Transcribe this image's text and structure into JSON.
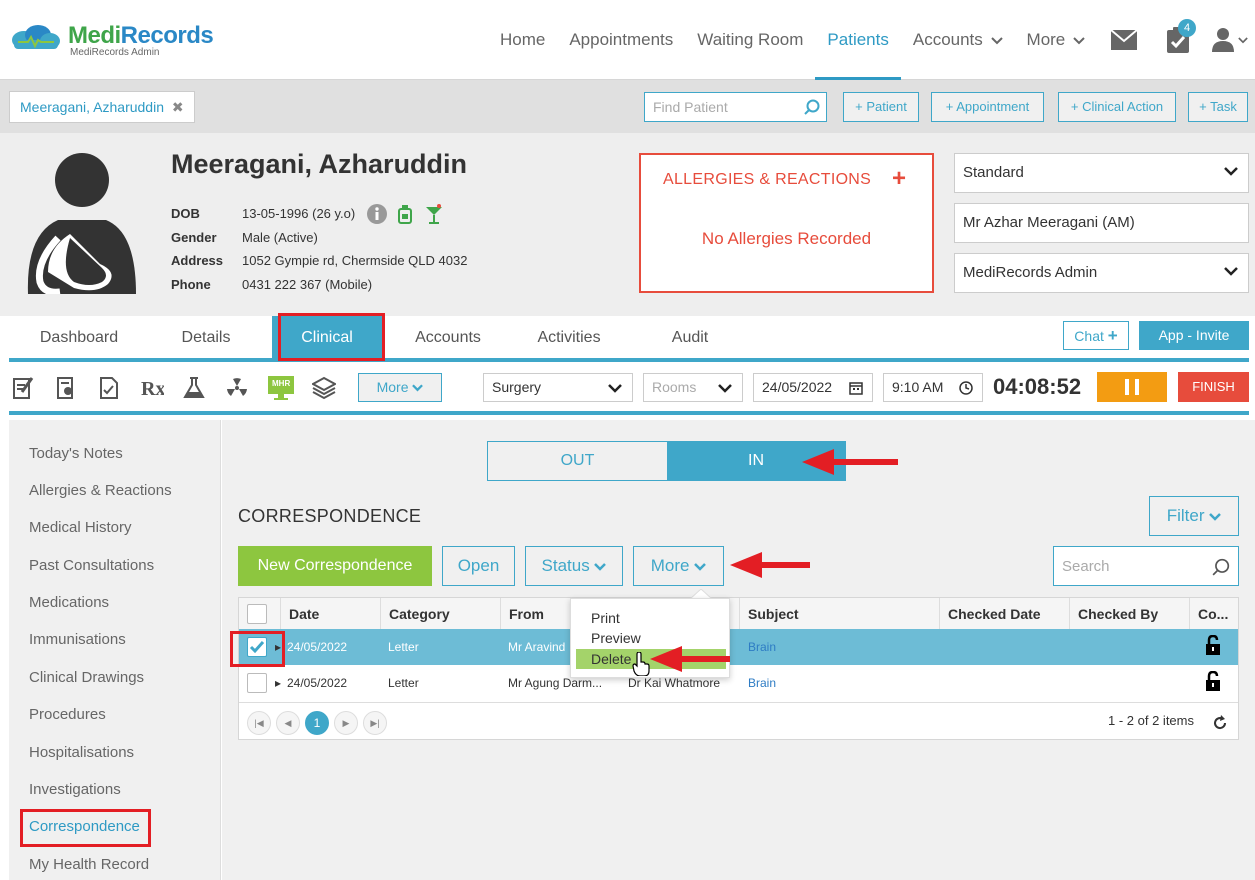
{
  "app": {
    "logo_medi": "Medi",
    "logo_records": "Records",
    "logo_sub": "MediRecords Admin"
  },
  "nav": {
    "items": [
      {
        "label": "Home"
      },
      {
        "label": "Appointments"
      },
      {
        "label": "Waiting Room"
      },
      {
        "label": "Patients",
        "active": true
      },
      {
        "label": "Accounts"
      },
      {
        "label": "More"
      }
    ],
    "task_count": "4"
  },
  "strip": {
    "patient_tab": "Meeragani, Azharuddin",
    "find_placeholder": "Find Patient",
    "quick_buttons": [
      "+ Patient",
      "+ Appointment",
      "+ Clinical Action",
      "+ Task"
    ]
  },
  "patient": {
    "name": "Meeragani, Azharuddin",
    "fields": [
      {
        "label": "DOB",
        "value": "13-05-1996 (26 y.o)"
      },
      {
        "label": "Gender",
        "value": "Male (Active)"
      },
      {
        "label": "Address",
        "value": "1052 Gympie rd, Chermside QLD 4032"
      },
      {
        "label": "Phone",
        "value": "0431 222 367 (Mobile)"
      }
    ]
  },
  "allergies": {
    "title": "ALLERGIES & REACTIONS",
    "message": "No Allergies Recorded"
  },
  "selects": {
    "plan": "Standard",
    "doctor": "Mr Azhar Meeragani (AM)",
    "practice": "MediRecords Admin"
  },
  "tabs": [
    "Dashboard",
    "Details",
    "Clinical",
    "Accounts",
    "Activities",
    "Audit"
  ],
  "tab_buttons": {
    "chat": "Chat",
    "invite": "App - Invite"
  },
  "toolbar": {
    "more": "More",
    "location": "Surgery",
    "rooms_placeholder": "Rooms",
    "date": "24/05/2022",
    "time": "9:10 AM",
    "timer": "04:08:52",
    "finish": "FINISH",
    "mhr": "MHR"
  },
  "sidebar": {
    "items": [
      "Today's Notes",
      "Allergies & Reactions",
      "Medical History",
      "Past Consultations",
      "Medications",
      "Immunisations",
      "Clinical Drawings",
      "Procedures",
      "Hospitalisations",
      "Investigations",
      "Correspondence",
      "My Health Record"
    ]
  },
  "main": {
    "toggle_out": "OUT",
    "toggle_in": "IN",
    "title": "CORRESPONDENCE",
    "filter": "Filter",
    "new_button": "New Correspondence",
    "open_button": "Open",
    "status_button": "Status",
    "more_button": "More",
    "search_placeholder": "Search"
  },
  "grid": {
    "columns": [
      "Date",
      "Category",
      "From",
      "To",
      "Subject",
      "Checked Date",
      "Checked By",
      "Co..."
    ],
    "rows": [
      {
        "date": "24/05/2022",
        "category": "Letter",
        "from": "Mr Aravind",
        "to": "",
        "subject": "Brain",
        "checked_date": "",
        "checked_by": "",
        "selected": true
      },
      {
        "date": "24/05/2022",
        "category": "Letter",
        "from": "Mr Agung Darm...",
        "to": "Dr Kai Whatmore",
        "subject": "Brain",
        "checked_date": "",
        "checked_by": "",
        "selected": false
      }
    ],
    "page": "1",
    "items_text": "1 - 2 of 2 items"
  },
  "more_menu": {
    "items": [
      "Print",
      "Preview",
      "Delete"
    ]
  }
}
